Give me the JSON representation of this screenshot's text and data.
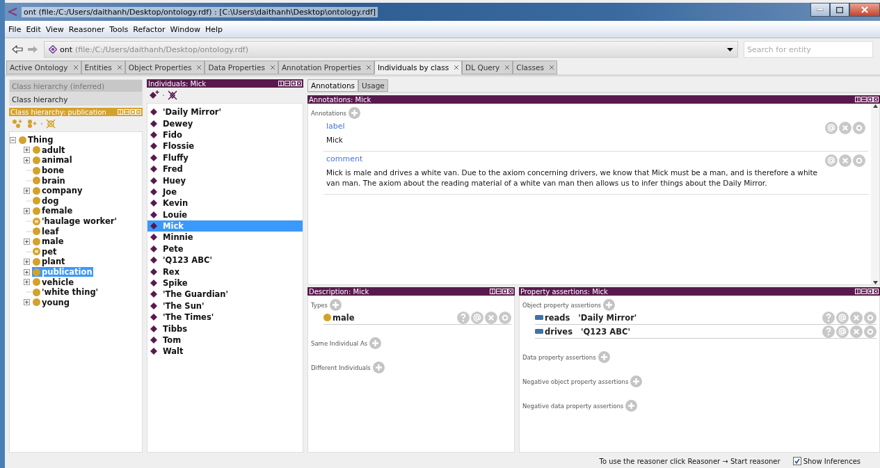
{
  "window": {
    "title": "ont (file:/C:/Users/daithanh/Desktop/ontology.rdf)  : [C:\\Users\\daithanh\\Desktop\\ontology.rdf]"
  },
  "menu": [
    "File",
    "Edit",
    "View",
    "Reasoner",
    "Tools",
    "Refactor",
    "Window",
    "Help"
  ],
  "toolbar": {
    "ontology_name": "ont",
    "ontology_iri": "(file:/C:/Users/daithanh/Desktop/ontology.rdf)",
    "search": {
      "placeholder": "Search for entity"
    }
  },
  "tabs": [
    {
      "label": "Active Ontology",
      "selected": false
    },
    {
      "label": "Entities",
      "selected": false
    },
    {
      "label": "Object Properties",
      "selected": false
    },
    {
      "label": "Data Properties",
      "selected": false
    },
    {
      "label": "Annotation Properties",
      "selected": false
    },
    {
      "label": "Individuals by class",
      "selected": true
    },
    {
      "label": "DL Query",
      "selected": false
    },
    {
      "label": "Classes",
      "selected": false
    }
  ],
  "class_views": [
    {
      "label": "Class hierarchy (inferred)",
      "selected": false
    },
    {
      "label": "Class hierarchy",
      "selected": true
    }
  ],
  "class_hierarchy": {
    "title": "Class hierarchy: publication",
    "tree": [
      {
        "label": "Thing",
        "kind": "class",
        "expanded": true,
        "selected": false,
        "children": [
          {
            "label": "adult",
            "kind": "class",
            "expanded": false,
            "selected": false
          },
          {
            "label": "animal",
            "kind": "class",
            "expanded": false,
            "selected": false
          },
          {
            "label": "bone",
            "kind": "class",
            "selected": false
          },
          {
            "label": "brain",
            "kind": "class",
            "selected": false
          },
          {
            "label": "company",
            "kind": "class",
            "expanded": false,
            "selected": false
          },
          {
            "label": "dog",
            "kind": "class",
            "selected": false
          },
          {
            "label": "female",
            "kind": "class",
            "expanded": false,
            "selected": false
          },
          {
            "label": "'haulage worker'",
            "kind": "defined",
            "selected": false
          },
          {
            "label": "leaf",
            "kind": "class",
            "selected": false
          },
          {
            "label": "male",
            "kind": "class",
            "expanded": false,
            "selected": false
          },
          {
            "label": "pet",
            "kind": "defined",
            "selected": false
          },
          {
            "label": "plant",
            "kind": "class",
            "expanded": false,
            "selected": false
          },
          {
            "label": "publication",
            "kind": "class",
            "expanded": false,
            "selected": true
          },
          {
            "label": "vehicle",
            "kind": "class",
            "expanded": false,
            "selected": false
          },
          {
            "label": "'white thing'",
            "kind": "class",
            "selected": false
          },
          {
            "label": "young",
            "kind": "class",
            "expanded": false,
            "selected": false
          }
        ]
      }
    ]
  },
  "individuals": {
    "title": "Individuals: Mick",
    "items": [
      {
        "label": "'Daily Mirror'",
        "selected": false
      },
      {
        "label": "Dewey",
        "selected": false
      },
      {
        "label": "Fido",
        "selected": false
      },
      {
        "label": "Flossie",
        "selected": false
      },
      {
        "label": "Fluffy",
        "selected": false
      },
      {
        "label": "Fred",
        "selected": false
      },
      {
        "label": "Huey",
        "selected": false
      },
      {
        "label": "Joe",
        "selected": false
      },
      {
        "label": "Kevin",
        "selected": false
      },
      {
        "label": "Louie",
        "selected": false
      },
      {
        "label": "Mick",
        "selected": true
      },
      {
        "label": "Minnie",
        "selected": false
      },
      {
        "label": "Pete",
        "selected": false
      },
      {
        "label": "'Q123 ABC'",
        "selected": false
      },
      {
        "label": "Rex",
        "selected": false
      },
      {
        "label": "Spike",
        "selected": false
      },
      {
        "label": "'The Guardian'",
        "selected": false
      },
      {
        "label": "'The Sun'",
        "selected": false
      },
      {
        "label": "'The Times'",
        "selected": false
      },
      {
        "label": "Tibbs",
        "selected": false
      },
      {
        "label": "Tom",
        "selected": false
      },
      {
        "label": "Walt",
        "selected": false
      }
    ]
  },
  "entity_tabs": [
    {
      "label": "Annotations",
      "selected": true
    },
    {
      "label": "Usage",
      "selected": false
    }
  ],
  "annotations": {
    "title": "Annotations: Mick",
    "section": "Annotations",
    "items": [
      {
        "property": "label",
        "value": "Mick"
      },
      {
        "property": "comment",
        "value": "Mick is male and drives a white van. Due to the axiom concerning drivers, we know that Mick must be a man, and is therefore a white van man. The axiom about the reading material of a white van man then allows us to infer things about the Daily Mirror."
      }
    ]
  },
  "description": {
    "title": "Description: Mick",
    "sections": [
      {
        "label": "Types",
        "items": [
          {
            "label": "male"
          }
        ]
      },
      {
        "label": "Same Individual As"
      },
      {
        "label": "Different Individuals"
      }
    ]
  },
  "property_assertions": {
    "title": "Property assertions: Mick",
    "sections": [
      {
        "label": "Object property assertions",
        "items": [
          {
            "property": "reads",
            "value": "'Daily Mirror'"
          },
          {
            "property": "drives",
            "value": "'Q123 ABC'"
          }
        ]
      },
      {
        "label": "Data property assertions"
      },
      {
        "label": "Negative object property assertions"
      },
      {
        "label": "Negative data property assertions"
      }
    ]
  },
  "status_bar": {
    "message": "To use the reasoner click Reasoner → Start reasoner",
    "show_inferences": {
      "label": "Show Inferences",
      "checked": true
    }
  }
}
